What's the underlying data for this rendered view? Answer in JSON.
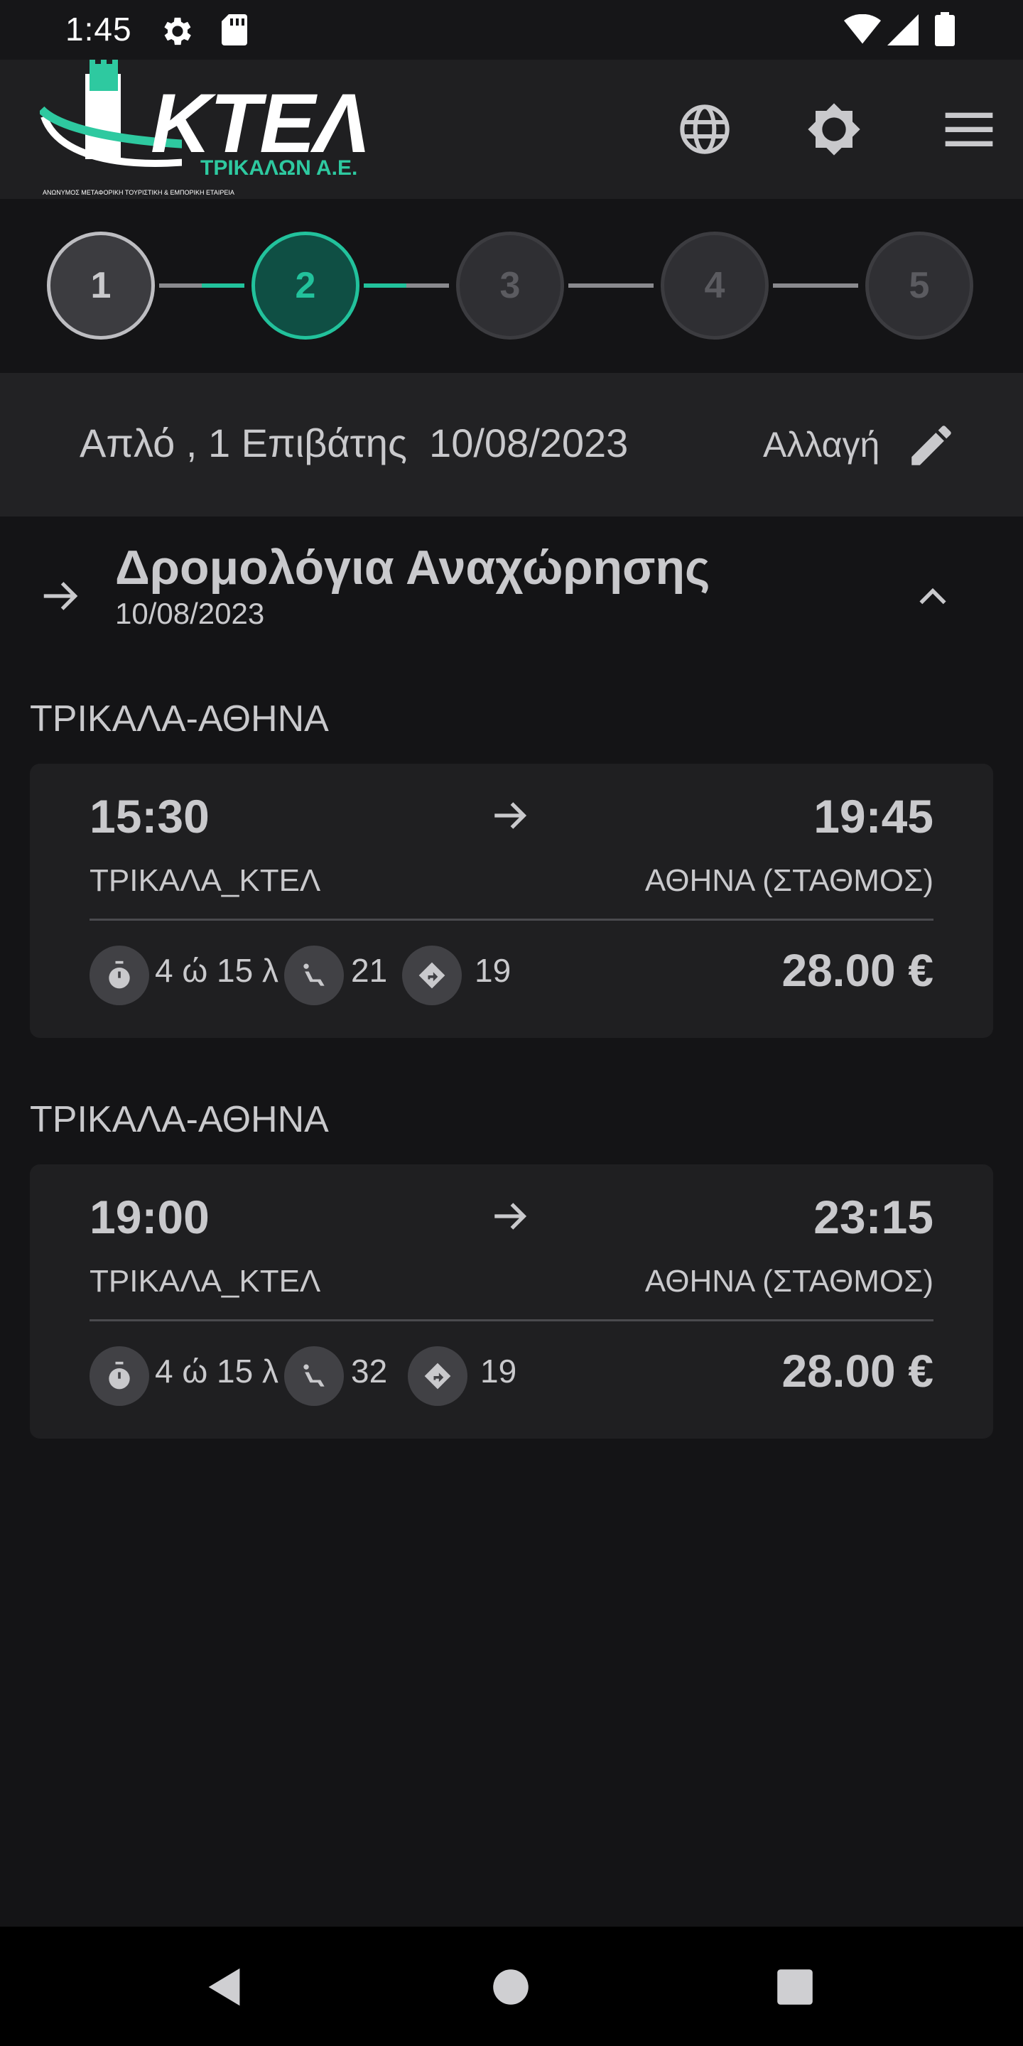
{
  "status_bar": {
    "time": "1:45",
    "icons": [
      "gear-icon",
      "sd-card-icon",
      "wifi-icon",
      "signal-icon",
      "battery-icon"
    ]
  },
  "header": {
    "logo_text": "ΚΤΕΛ",
    "logo_subtitle": "ΤΡΙΚΑΛΩΝ Α.Ε.",
    "logo_tagline": "ΑΝΩΝΥΜΟΣ ΜΕΤΑΦΟΡΙΚΗ ΤΟΥΡΙΣΤΙΚΗ & ΕΜΠΟΡΙΚΗ ΕΤΑΙΡΕΙΑ",
    "icons": [
      "globe-icon",
      "brightness-icon",
      "menu-icon"
    ]
  },
  "stepper": {
    "steps": [
      "1",
      "2",
      "3",
      "4",
      "5"
    ],
    "current": 2
  },
  "summary": {
    "text": "Απλό , 1 Επιβάτης  10/08/2023",
    "change_label": "Αλλαγή"
  },
  "section": {
    "title": "Δρομολόγια Αναχώρησης",
    "date": "10/08/2023"
  },
  "trips": [
    {
      "route": "ΤΡΙΚΑΛΑ-ΑΘΗΝΑ",
      "departure_time": "15:30",
      "arrival_time": "19:45",
      "departure_station": "ΤΡΙΚΑΛΑ_ΚΤΕΛ",
      "arrival_station": "ΑΘΗΝΑ (ΣΤΑΘΜΟΣ)",
      "duration": "4 ώ 15 λ",
      "seats": "21",
      "distance": "19",
      "price": "28.00 €"
    },
    {
      "route": "ΤΡΙΚΑΛΑ-ΑΘΗΝΑ",
      "departure_time": "19:00",
      "arrival_time": "23:15",
      "departure_station": "ΤΡΙΚΑΛΑ_ΚΤΕΛ",
      "arrival_station": "ΑΘΗΝΑ (ΣΤΑΘΜΟΣ)",
      "duration": "4 ώ 15 λ",
      "seats": "32",
      "distance": "19",
      "price": "28.00 €"
    }
  ],
  "colors": {
    "background": "#141416",
    "surface": "#1f1f21",
    "accent": "#22c29c",
    "text": "#c9c9cc"
  }
}
